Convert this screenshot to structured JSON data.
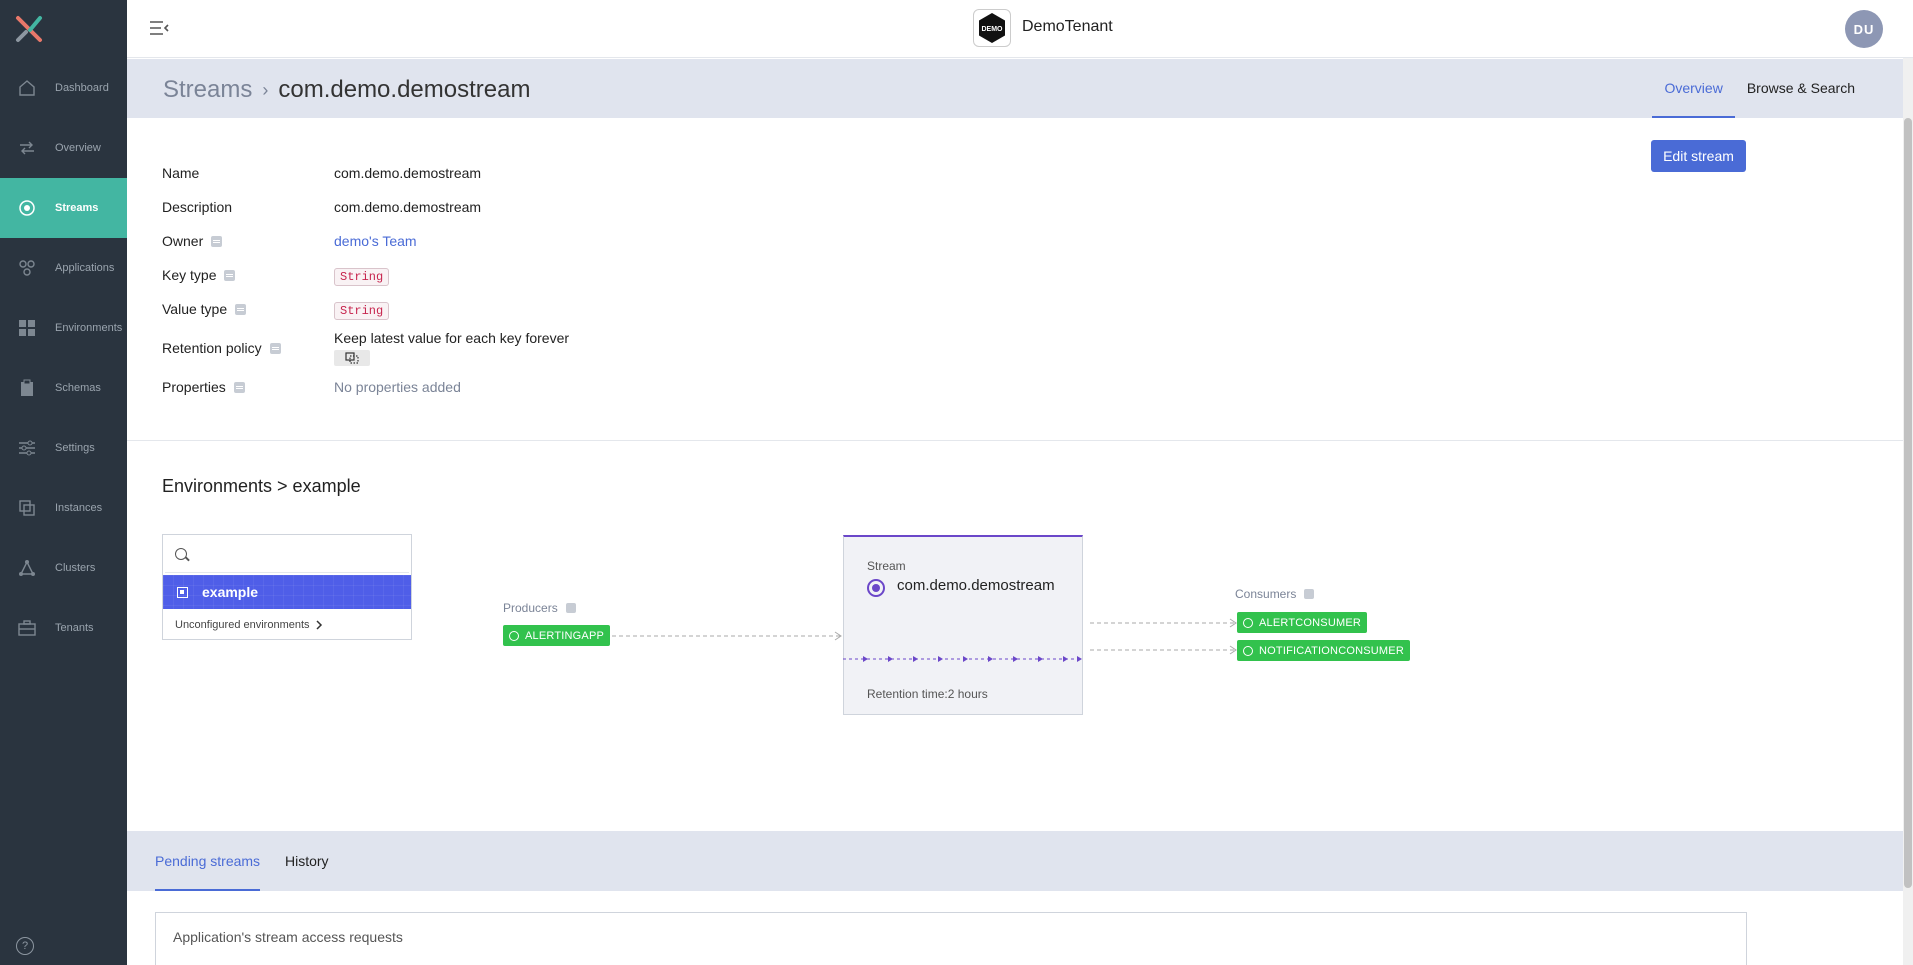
{
  "sidebar": {
    "items": [
      {
        "label": "Dashboard",
        "icon": "home-icon"
      },
      {
        "label": "Overview",
        "icon": "arrows-icon"
      },
      {
        "label": "Streams",
        "icon": "stream-icon",
        "active": true
      },
      {
        "label": "Applications",
        "icon": "applications-icon"
      },
      {
        "label": "Environments",
        "icon": "grid-icon"
      },
      {
        "label": "Schemas",
        "icon": "clipboard-icon"
      },
      {
        "label": "Settings",
        "icon": "sliders-icon"
      },
      {
        "label": "Instances",
        "icon": "instances-icon"
      },
      {
        "label": "Clusters",
        "icon": "cluster-icon"
      },
      {
        "label": "Tenants",
        "icon": "briefcase-icon"
      }
    ],
    "help": "?"
  },
  "topbar": {
    "tenant_logo_text": "DEMO",
    "tenant_name": "DemoTenant",
    "avatar": "DU"
  },
  "header": {
    "breadcrumb_root": "Streams",
    "breadcrumb_sep": "›",
    "breadcrumb_current": "com.demo.demostream",
    "tabs": [
      "Overview",
      "Browse & Search"
    ]
  },
  "details": {
    "name_label": "Name",
    "name": "com.demo.demostream",
    "description_label": "Description",
    "description": "com.demo.demostream",
    "owner_label": "Owner",
    "owner": "demo's Team",
    "key_type_label": "Key type",
    "key_type": "String",
    "value_type_label": "Value type",
    "value_type": "String",
    "retention_label": "Retention policy",
    "retention": "Keep latest value for each key forever",
    "properties_label": "Properties",
    "properties": "No properties added",
    "edit_button": "Edit stream"
  },
  "environments": {
    "title": "Environments > example",
    "search_placeholder": "",
    "selected": "example",
    "unconfigured": "Unconfigured environments"
  },
  "diagram": {
    "producers_label": "Producers",
    "producers": [
      "ALERTINGAPP"
    ],
    "stream_label": "Stream",
    "stream_name": "com.demo.demostream",
    "retention": "Retention time:2 hours",
    "consumers_label": "Consumers",
    "consumers": [
      "ALERTCONSUMER",
      "NOTIFICATIONCONSUMER"
    ],
    "accent": "#6b47c9",
    "app_color": "#32c24d"
  },
  "bottom": {
    "tabs": [
      "Pending streams",
      "History"
    ],
    "requests_title": "Application's stream access requests"
  }
}
